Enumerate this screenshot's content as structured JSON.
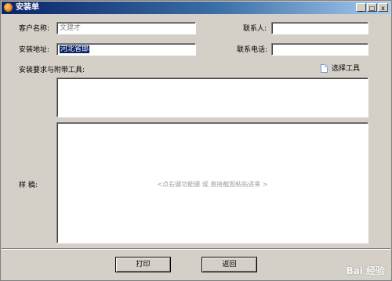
{
  "window": {
    "title": "安装单"
  },
  "caption_buttons": {
    "minimize": "_",
    "maximize": "□",
    "close": "x"
  },
  "form": {
    "customer_label": "客户名称:",
    "customer_value": "文建才",
    "contact_label": "联系人:",
    "contact_value": "",
    "address_label": "安装地址:",
    "address_value": "河北省邯",
    "phone_label": "联系电话:",
    "phone_value": "",
    "requirements_label": "安装要求与附带工具:",
    "select_tool": "选择工具",
    "sample_label": "样    稿:",
    "sample_hint": "<点右键功能键 或 直接截图粘贴进来 >"
  },
  "buttons": {
    "print": "打印",
    "back": "返回"
  },
  "watermark": "Bai 经验"
}
